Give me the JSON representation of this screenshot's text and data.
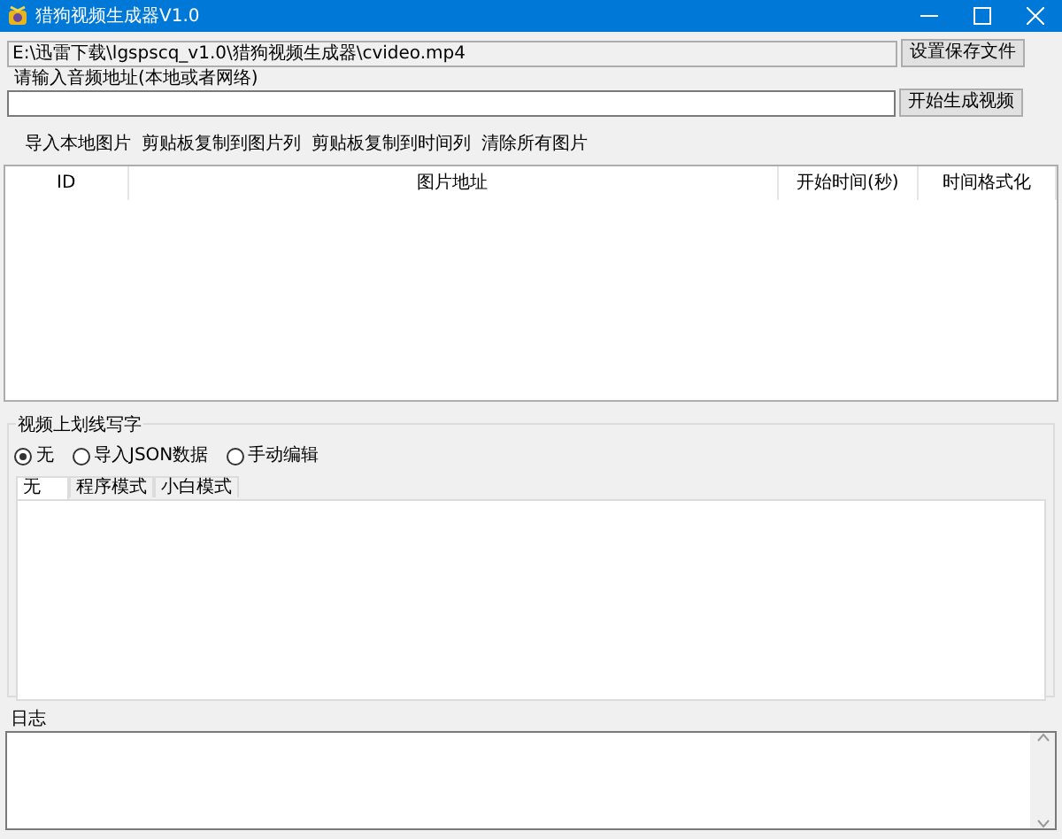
{
  "window": {
    "title": "猎狗视频生成器V1.0"
  },
  "output_path": {
    "value": "E:\\迅雷下载\\lgspscq_v1.0\\猎狗视频生成器\\cvideo.mp4",
    "button": "设置保存文件"
  },
  "audio": {
    "label": "请输入音频地址(本地或者网络)",
    "button": "开始生成视频"
  },
  "toolbar": [
    "导入本地图片",
    "剪贴板复制到图片列",
    "剪贴板复制到时间列",
    "清除所有图片"
  ],
  "table": {
    "columns": [
      "ID",
      "图片地址",
      "开始时间(秒)",
      "时间格式化"
    ]
  },
  "overlay_group": {
    "title": "视频上划线写字",
    "radios": [
      {
        "label": "无",
        "selected": true
      },
      {
        "label": "导入JSON数据",
        "selected": false
      },
      {
        "label": "手动编辑",
        "selected": false
      }
    ],
    "tabs": [
      {
        "label": "无",
        "selected": true
      },
      {
        "label": "程序模式",
        "selected": false
      },
      {
        "label": "小白模式",
        "selected": false
      }
    ]
  },
  "log": {
    "label": "日志"
  }
}
